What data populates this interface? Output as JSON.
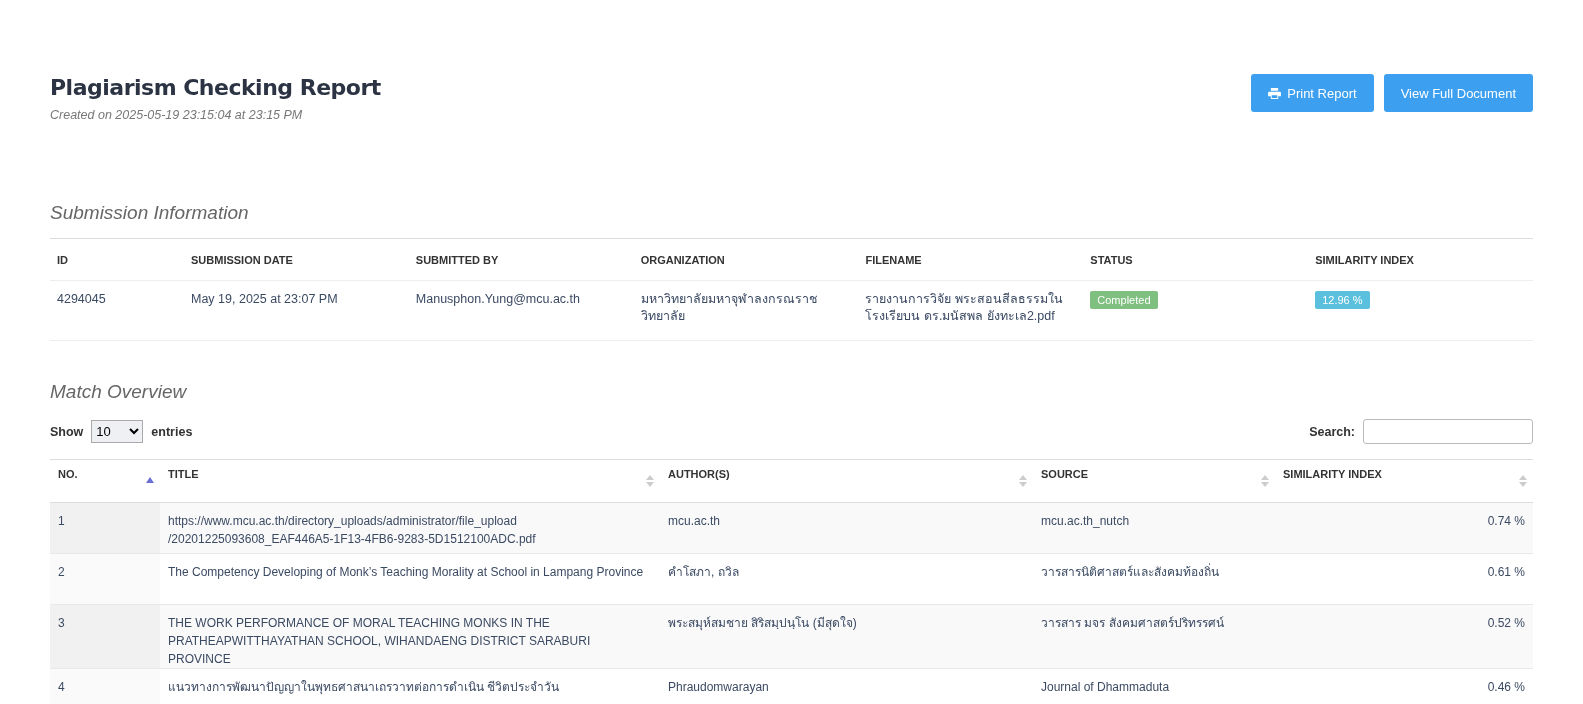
{
  "header": {
    "title": "Plagiarism Checking Report",
    "subtitle": "Created on 2025-05-19 23:15:04 at 23:15 PM",
    "buttons": [
      {
        "label": "Print Report",
        "kind": "print"
      },
      {
        "label": "View Full Document",
        "kind": "plain"
      }
    ]
  },
  "submission": {
    "heading": "Submission Information",
    "columns": [
      "ID",
      "SUBMISSION DATE",
      "SUBMITTED BY",
      "ORGANIZATION",
      "FILENAME",
      "STATUS",
      "SIMILARITY INDEX"
    ],
    "row": {
      "id": "4294045",
      "date": "May 19, 2025 at 23:07 PM",
      "submitted_by": "Manusphon.Yung@mcu.ac.th",
      "organization": "มหาวิทยาลัยมหาจุฬาลงกรณราชวิทยาลัย",
      "filename": "รายงานการวิจัย พระสอนสีลธรรมในโรงเรียบน ดร.มนัสพล ยังทะเล2.pdf",
      "status": {
        "label": "Completed",
        "color": "#7fbf7f"
      },
      "similarity": {
        "label": "12.96 %",
        "color": "#5bc0de"
      }
    }
  },
  "matches": {
    "heading": "Match Overview",
    "length_label_before": "Show",
    "length_value": "10",
    "length_label_after": "entries",
    "search_label": "Search:",
    "columns": [
      {
        "label": "NO.",
        "sorted": true
      },
      {
        "label": "TITLE",
        "sorted": false
      },
      {
        "label": "AUTHOR(S)",
        "sorted": false
      },
      {
        "label": "SOURCE",
        "sorted": false
      },
      {
        "label": "SIMILARITY INDEX",
        "sorted": false
      }
    ],
    "rows": [
      {
        "no": "1",
        "title": "https://www.mcu.ac.th/directory_uploads/administrator/file_upload /20201225093608_EAF446A5-1F13-4FB6-9283-5D1512100ADC.pdf",
        "authors": "mcu.ac.th",
        "source": "mcu.ac.th_nutch",
        "similarity": "0.74 %"
      },
      {
        "no": "2",
        "title": "The Competency Developing of Monk’s Teaching Morality at School in Lampang Province",
        "authors": "คำโสภา, ถวิล",
        "source": "วารสารนิติศาสตร์และสังคมท้องถิ่น",
        "similarity": "0.61 %"
      },
      {
        "no": "3",
        "title": "THE WORK PERFORMANCE OF MORAL TEACHING MONKS IN THE PRATHEAPWITTHAYATHAN SCHOOL, WIHANDAENG DISTRICT SARABURI PROVINCE",
        "authors": "พระสมุห์สมชาย สิริสมฺปนฺโน (มีสุดใจ)",
        "source": "วารสาร มจร สังคมศาสตร์ปริทรรศน์",
        "similarity": "0.52 %"
      },
      {
        "no": "4",
        "title": "แนวทางการพัฒนาปัญญาในพุทธศาสนาเถรวาทต่อการดำเนิน ชีวิตประจำวัน",
        "authors": "Phraudomwarayan",
        "source": "Journal of Dhammaduta",
        "similarity": "0.46 %"
      }
    ]
  }
}
